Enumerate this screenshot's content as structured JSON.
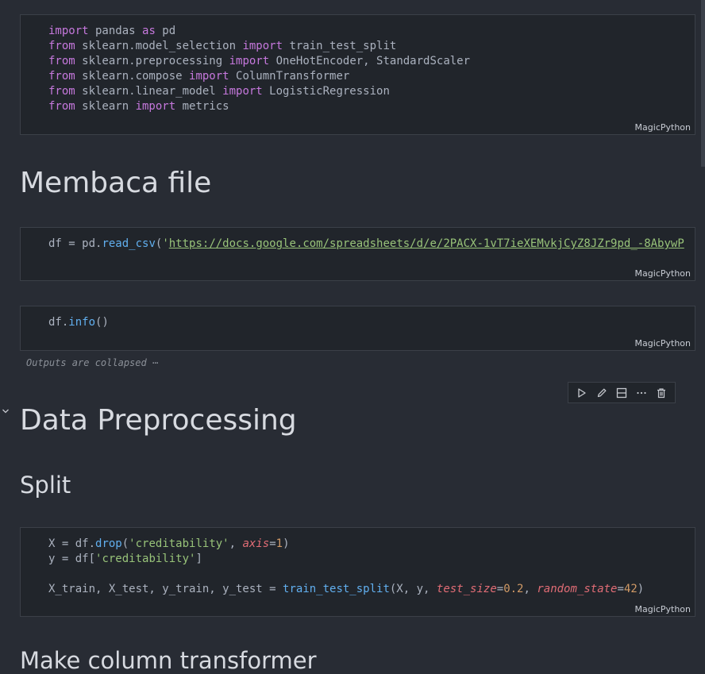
{
  "cells": {
    "imports": {
      "lines": [
        [
          {
            "t": "import",
            "c": "kw"
          },
          {
            "t": " pandas "
          },
          {
            "t": "as",
            "c": "kw"
          },
          {
            "t": " pd"
          }
        ],
        [
          {
            "t": "from",
            "c": "kw"
          },
          {
            "t": " sklearn.model_selection "
          },
          {
            "t": "import",
            "c": "kw"
          },
          {
            "t": " train_test_split"
          }
        ],
        [
          {
            "t": "from",
            "c": "kw"
          },
          {
            "t": " sklearn.preprocessing "
          },
          {
            "t": "import",
            "c": "kw"
          },
          {
            "t": " OneHotEncoder, StandardScaler"
          }
        ],
        [
          {
            "t": "from",
            "c": "kw"
          },
          {
            "t": " sklearn.compose "
          },
          {
            "t": "import",
            "c": "kw"
          },
          {
            "t": " ColumnTransformer"
          }
        ],
        [
          {
            "t": "from",
            "c": "kw"
          },
          {
            "t": " sklearn.linear_model "
          },
          {
            "t": "import",
            "c": "kw"
          },
          {
            "t": " LogisticRegression"
          }
        ],
        [
          {
            "t": "from",
            "c": "kw"
          },
          {
            "t": " sklearn "
          },
          {
            "t": "import",
            "c": "kw"
          },
          {
            "t": " metrics"
          }
        ]
      ],
      "language": "MagicPython"
    },
    "read_csv": {
      "lines": [
        [
          {
            "t": "df = pd."
          },
          {
            "t": "read_csv",
            "c": "fn"
          },
          {
            "t": "("
          },
          {
            "t": "'",
            "c": "str"
          },
          {
            "t": "https://docs.google.com/spreadsheets/d/e/2PACX-1vT7ieXEMvkjCyZ8JZr9pd_-8AbywP",
            "c": "url"
          }
        ]
      ],
      "language": "MagicPython"
    },
    "info": {
      "lines": [
        [
          {
            "t": "df."
          },
          {
            "t": "info",
            "c": "fn"
          },
          {
            "t": "()"
          }
        ]
      ],
      "language": "MagicPython",
      "collapsed_text": "Outputs are collapsed ⋯"
    },
    "split": {
      "lines": [
        [
          {
            "t": "X = df."
          },
          {
            "t": "drop",
            "c": "fn"
          },
          {
            "t": "("
          },
          {
            "t": "'creditability'",
            "c": "str"
          },
          {
            "t": ", "
          },
          {
            "t": "axis",
            "c": "param"
          },
          {
            "t": "="
          },
          {
            "t": "1",
            "c": "num"
          },
          {
            "t": ")"
          }
        ],
        [
          {
            "t": "y = df["
          },
          {
            "t": "'creditability'",
            "c": "str"
          },
          {
            "t": "]"
          }
        ],
        [
          {
            "t": ""
          }
        ],
        [
          {
            "t": "X_train, X_test, y_train, y_test = "
          },
          {
            "t": "train_test_split",
            "c": "fn"
          },
          {
            "t": "(X, y, "
          },
          {
            "t": "test_size",
            "c": "param"
          },
          {
            "t": "="
          },
          {
            "t": "0.2",
            "c": "num"
          },
          {
            "t": ", "
          },
          {
            "t": "random_state",
            "c": "param"
          },
          {
            "t": "="
          },
          {
            "t": "42",
            "c": "num"
          },
          {
            "t": ")"
          }
        ]
      ],
      "language": "MagicPython"
    }
  },
  "markdown": {
    "membaca": "Membaca file",
    "preprocessing": "Data Preprocessing",
    "split": "Split",
    "transformer": "Make column transformer"
  },
  "toolbar": {
    "icons": [
      "run-icon",
      "edit-icon",
      "split-cell-icon",
      "more-icon",
      "delete-icon"
    ]
  }
}
